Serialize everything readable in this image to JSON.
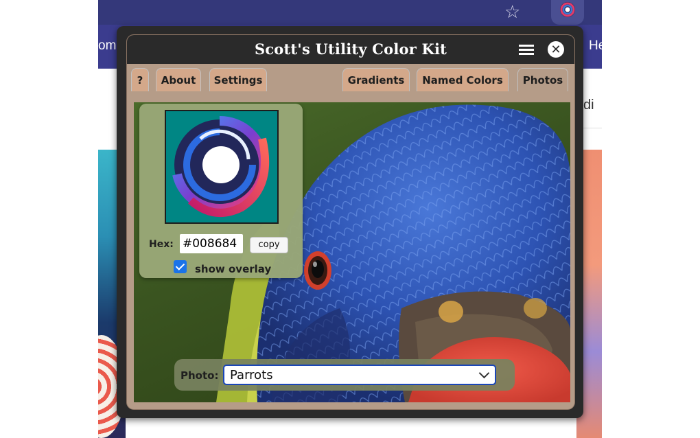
{
  "browser": {
    "nav_left_text": "ome",
    "nav_right_text": "He",
    "peek_text": "di"
  },
  "kit": {
    "title": "Scott's Utility Color Kit",
    "tabs": [
      {
        "label": "?"
      },
      {
        "label": "About"
      },
      {
        "label": "Settings"
      },
      {
        "label": "Gradients"
      },
      {
        "label": "Named Colors"
      },
      {
        "label": "Photos"
      }
    ],
    "active_tab": "Photos"
  },
  "swatch": {
    "color": "#008684",
    "hex_label": "Hex:",
    "hex_value": "#008684",
    "copy_label": "copy",
    "overlay_label": "show overlay",
    "overlay_checked": true
  },
  "photo": {
    "label": "Photo:",
    "selected": "Parrots"
  },
  "colors": {
    "title_bar": "#2a2a2a",
    "tab_inactive": "#d4a88a",
    "tab_active": "#b59c88",
    "select_border": "#1a46b8",
    "checkbox": "#1a73e8"
  },
  "icons": [
    "star-icon",
    "extension-icon",
    "menu-icon",
    "close-icon",
    "chevron-down-icon",
    "checkbox-checked-icon"
  ]
}
